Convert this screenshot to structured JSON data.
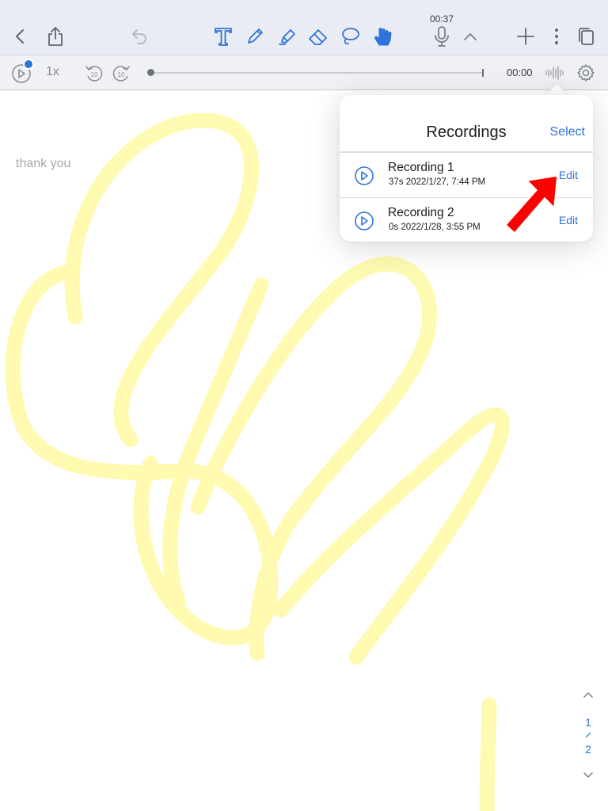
{
  "toolbar": {
    "recording_time": "00:37",
    "icons": [
      "chevron-left-icon",
      "share-icon",
      "undo-icon",
      "text-tool-icon",
      "pen-icon",
      "highlighter-icon",
      "eraser-icon",
      "lasso-icon",
      "hand-pointer-icon",
      "microphone-icon",
      "chevron-up-icon",
      "plus-icon",
      "more-vertical-icon",
      "pages-icon"
    ]
  },
  "audio_bar": {
    "speed": "1x",
    "skip_back": "10",
    "skip_forward": "10",
    "time": "00:00",
    "progress": 0
  },
  "note": {
    "text": "thank you"
  },
  "recordings_popover": {
    "title": "Recordings",
    "select_label": "Select",
    "items": [
      {
        "name": "Recording 1",
        "meta": "37s 2022/1/27, 7:44 PM",
        "edit_label": "Edit"
      },
      {
        "name": "Recording 2",
        "meta": "0s 2022/1/28, 3:55 PM",
        "edit_label": "Edit"
      }
    ]
  },
  "pager": {
    "current": "1",
    "total": "2"
  },
  "colors": {
    "accent": "#2e73d9",
    "highlighter": "#fffaa8",
    "annotation_arrow": "#ff0000",
    "toolbar_bg": "#e9ecf4"
  }
}
